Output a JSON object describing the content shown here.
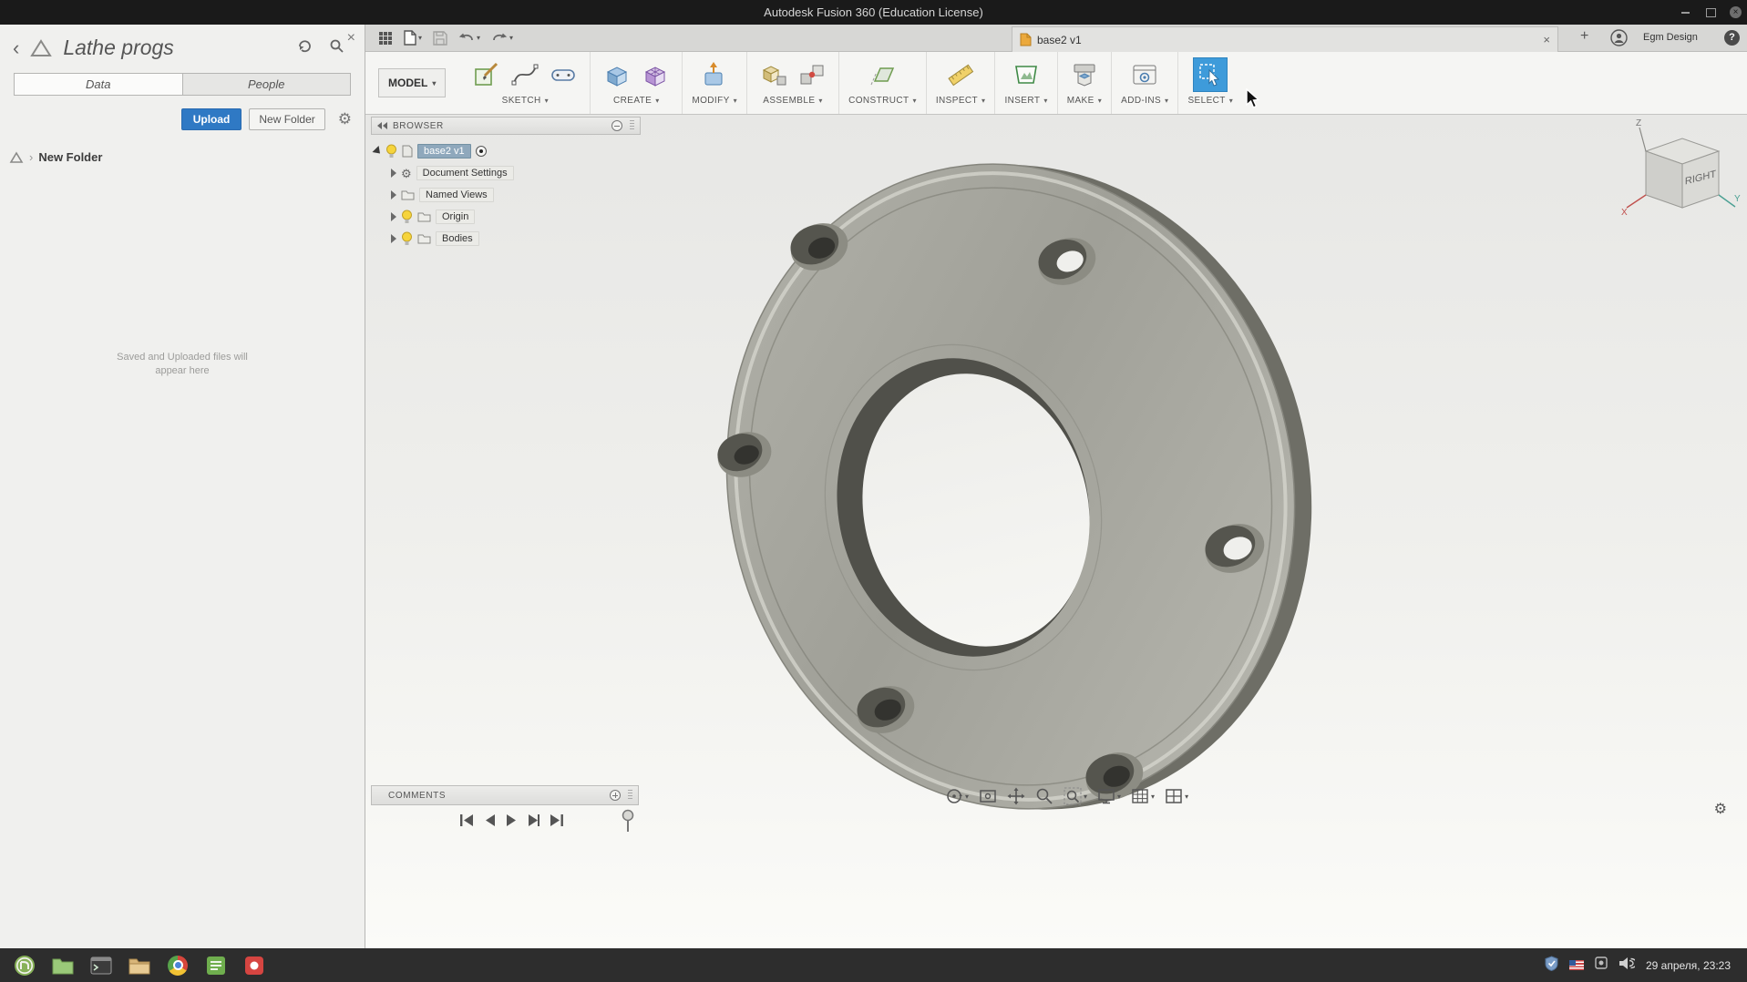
{
  "window": {
    "title": "Autodesk Fusion 360 (Education License)"
  },
  "icons": {
    "caret_down": "▾",
    "gear": "⚙",
    "close": "×",
    "back": "‹",
    "crumb_sep": "›",
    "plus": "+",
    "help": "?"
  },
  "data_panel": {
    "title": "Lathe progs",
    "tab_data": "Data",
    "tab_people": "People",
    "upload": "Upload",
    "new_folder": "New Folder",
    "breadcrumb_folder": "New Folder",
    "empty_1": "Saved and Uploaded files will",
    "empty_2": "appear here"
  },
  "tabstrip": {
    "doc": "base2 v1",
    "user": "Egm Design"
  },
  "ribbon": {
    "workspace": "MODEL",
    "groups": [
      {
        "label": "SKETCH"
      },
      {
        "label": "CREATE"
      },
      {
        "label": "MODIFY"
      },
      {
        "label": "ASSEMBLE"
      },
      {
        "label": "CONSTRUCT"
      },
      {
        "label": "INSPECT"
      },
      {
        "label": "INSERT"
      },
      {
        "label": "MAKE"
      },
      {
        "label": "ADD-INS"
      },
      {
        "label": "SELECT"
      }
    ]
  },
  "browser": {
    "header": "BROWSER",
    "root": "base2 v1",
    "items": [
      {
        "label": "Document Settings"
      },
      {
        "label": "Named Views"
      },
      {
        "label": "Origin"
      },
      {
        "label": "Bodies"
      }
    ]
  },
  "comments": {
    "header": "COMMENTS"
  },
  "viewcube": {
    "face": "RIGHT",
    "axis_x": "X",
    "axis_y": "Y",
    "axis_z": "Z"
  },
  "taskbar": {
    "clock": "29 апреля, 23:23"
  },
  "colors": {
    "accent_blue": "#3e9bda",
    "upload_blue": "#2f79c4",
    "selection": "#8fa8bc"
  }
}
